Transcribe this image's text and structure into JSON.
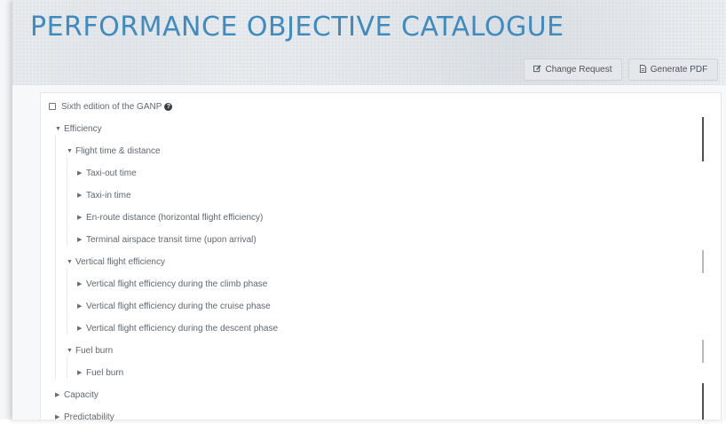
{
  "header": {
    "title": "PERFORMANCE OBJECTIVE CATALOGUE",
    "buttons": {
      "change_request": "Change Request",
      "generate_pdf": "Generate PDF"
    }
  },
  "filter": {
    "label": "Sixth edition of the GANP",
    "checked": false
  },
  "tree": {
    "efficiency": "Efficiency",
    "flight_time_distance": "Flight time & distance",
    "taxi_out": "Taxi-out time",
    "taxi_in": "Taxi-in time",
    "enroute_distance": "En-route distance (horizontal flight efficiency)",
    "terminal_transit": "Terminal airspace transit time (upon arrival)",
    "vertical_flight_efficiency": "Vertical flight efficiency",
    "vfe_climb": "Vertical flight efficiency during the climb phase",
    "vfe_cruise": "Vertical flight efficiency during the cruise phase",
    "vfe_descent": "Vertical flight efficiency during the descent phase",
    "fuel_burn_group": "Fuel burn",
    "fuel_burn_item": "Fuel burn",
    "capacity": "Capacity",
    "predictability": "Predictability"
  },
  "icons": {
    "expanded": "caret-down-icon",
    "collapsed": "caret-right-icon",
    "help": "question-circle-icon",
    "edit": "edit-icon",
    "pdf": "file-pdf-icon"
  },
  "colors": {
    "title": "#3e8bbf",
    "text": "#5f6870",
    "button_bg": "#e5e7ea"
  }
}
